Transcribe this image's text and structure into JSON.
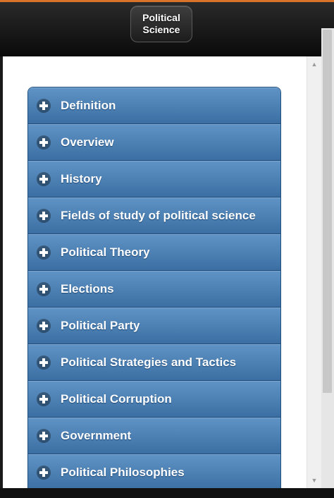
{
  "header": {
    "title_line1": "Political",
    "title_line2": "Science"
  },
  "menu": {
    "items": [
      {
        "label": "Definition",
        "icon": "plus-icon"
      },
      {
        "label": "Overview",
        "icon": "plus-icon"
      },
      {
        "label": "History",
        "icon": "plus-icon"
      },
      {
        "label": "Fields of study of political science",
        "icon": "plus-icon"
      },
      {
        "label": "Political Theory",
        "icon": "plus-icon"
      },
      {
        "label": "Elections",
        "icon": "plus-icon"
      },
      {
        "label": "Political Party",
        "icon": "plus-icon"
      },
      {
        "label": "Political Strategies and Tactics",
        "icon": "plus-icon"
      },
      {
        "label": "Political Corruption",
        "icon": "plus-icon"
      },
      {
        "label": "Government",
        "icon": "plus-icon"
      },
      {
        "label": "Political Philosophies",
        "icon": "plus-icon"
      }
    ]
  },
  "colors": {
    "accent": "#d9732b",
    "header_bg": "#111111",
    "item_bg_top": "#5f93c5",
    "item_bg_bottom": "#3b6fa3"
  }
}
